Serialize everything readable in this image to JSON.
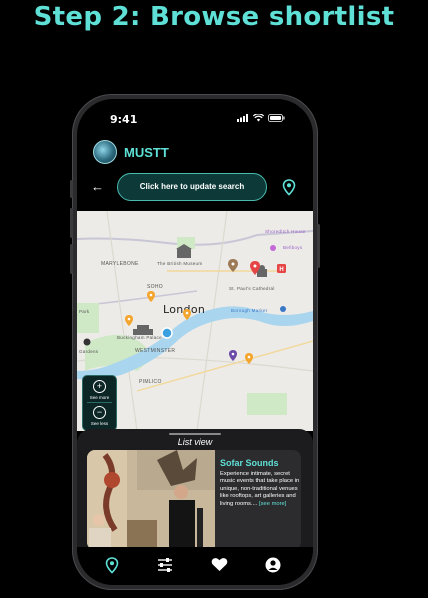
{
  "headline": "Step 2: Browse shortlist",
  "status": {
    "time": "9:41"
  },
  "app": {
    "name": "MUSTT"
  },
  "search": {
    "button_label": "Click here to update search"
  },
  "map": {
    "labels": {
      "marylebone": "MARYLEBONE",
      "british_museum": "The British Museum",
      "soho": "SOHO",
      "london": "London",
      "westminster": "WESTMINSTER",
      "pimlico": "PIMLICO",
      "st_pauls": "St. Paul's Cathedral",
      "borough_market": "Borough Market",
      "buckingham": "Buckingham Palace",
      "shoreditch": "Shoreditch House",
      "bellboys": "Bellboys",
      "park": "Park",
      "gardens": "Gardens"
    },
    "zoom": {
      "more": "See more",
      "less": "See less"
    }
  },
  "sheet": {
    "title": "List view",
    "card": {
      "title": "Sofar Sounds",
      "description": "Experience intimate, secret music events that take place in unique, non-traditional venues like rooftops, art galleries and living rooms....",
      "see_more": "[see more]"
    }
  },
  "colors": {
    "accent": "#5fe0d6",
    "pin_orange": "#f3a52e",
    "pin_purple": "#6b4aa8",
    "pin_red": "#e64545",
    "pin_brown": "#9c7a55"
  },
  "icons": [
    "location-pin-icon",
    "sliders-icon",
    "heart-icon",
    "user-icon",
    "back-arrow-icon"
  ]
}
